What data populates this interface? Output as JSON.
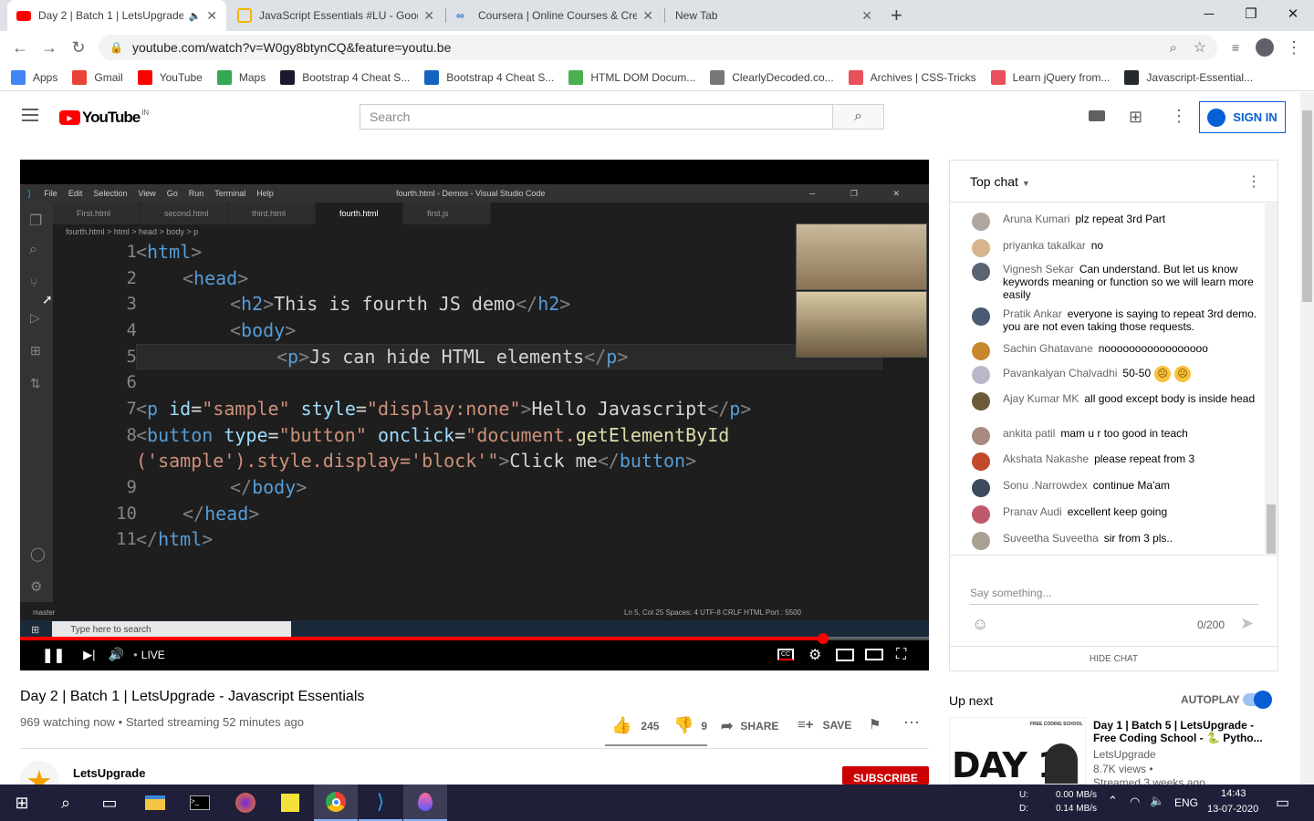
{
  "browser": {
    "tabs": [
      {
        "title": "Day 2 | Batch 1 | LetsUpgrade",
        "active": true,
        "icon": "youtube-favicon",
        "color": "#ff0000"
      },
      {
        "title": "JavaScript Essentials #LU - Goog",
        "active": false,
        "icon": "slides-favicon",
        "color": "#f4b400"
      },
      {
        "title": "Coursera | Online Courses & Cred",
        "active": false,
        "icon": "coursera-favicon",
        "color": "#2a73cc"
      },
      {
        "title": "New Tab",
        "active": false,
        "icon": "none",
        "color": "#dee1e6"
      }
    ],
    "url": "youtube.com/watch?v=W0gy8btynCQ&feature=youtu.be",
    "bookmarks": [
      {
        "label": "Apps",
        "icon": "apps-grid-icon",
        "color": "#4285f4"
      },
      {
        "label": "Gmail",
        "icon": "gmail-icon",
        "color": "#ea4335"
      },
      {
        "label": "YouTube",
        "icon": "youtube-icon",
        "color": "#ff0000"
      },
      {
        "label": "Maps",
        "icon": "maps-icon",
        "color": "#34a853"
      },
      {
        "label": "Bootstrap 4 Cheat S...",
        "icon": "h-icon",
        "color": "#1a1a2e"
      },
      {
        "label": "Bootstrap 4 Cheat S...",
        "icon": "arrow-icon",
        "color": "#1565c0"
      },
      {
        "label": "HTML DOM Docum...",
        "icon": "w3-icon",
        "color": "#4caf50"
      },
      {
        "label": "ClearlyDecoded.co...",
        "icon": "spiral-icon",
        "color": "#777777"
      },
      {
        "label": "Archives | CSS-Tricks",
        "icon": "star-icon",
        "color": "#e8505b"
      },
      {
        "label": "Learn jQuery from...",
        "icon": "star-icon",
        "color": "#e8505b"
      },
      {
        "label": "Javascript-Essential...",
        "icon": "github-icon",
        "color": "#24292e"
      }
    ]
  },
  "youtube": {
    "logo": "YouTube",
    "region": "IN",
    "search_placeholder": "Search",
    "signin_label": "SIGN IN"
  },
  "video": {
    "editor_title": "fourth.html - Demos - Visual Studio Code",
    "menu": [
      "File",
      "Edit",
      "Selection",
      "View",
      "Go",
      "Run",
      "Terminal",
      "Help"
    ],
    "file_tabs": [
      "First.html",
      "second.html",
      "third.html",
      "fourth.html",
      "first.js"
    ],
    "breadcrumb": "fourth.html > html > head > body > p",
    "line_numbers": [
      "1",
      "2",
      "3",
      "4",
      "5",
      "6",
      "7",
      "8",
      "",
      "9",
      "10",
      "11"
    ],
    "status_left": "master",
    "status_right": "Ln 5, Col 25   Spaces: 4   UTF-8   CRLF   HTML   Port : 5500",
    "taskbar_search": "Type here to search",
    "live_label": "LIVE",
    "progress_fraction": 0.884
  },
  "chat": {
    "header": "Top chat",
    "messages": [
      {
        "author": "Aruna Kumari",
        "text": "plz repeat 3rd Part",
        "avatar": "#b0a7a0"
      },
      {
        "author": "priyanka takalkar",
        "text": "no",
        "avatar": "#d8b48c"
      },
      {
        "author": "Vignesh Sekar",
        "text": "Can understand. But let us know keywords meaning or function so we will learn more easily",
        "avatar": "#5a6470"
      },
      {
        "author": "Pratik Ankar",
        "text": "everyone is saying to repeat 3rd demo. you are not even taking those requests.",
        "avatar": "#4a5a74"
      },
      {
        "author": "Sachin Ghatavane",
        "text": "nooooooooooooooooo",
        "avatar": "#c8872c"
      },
      {
        "author": "Pavankalyan Chalvadhi",
        "text": "50-50",
        "avatar": "#b8b8c8"
      },
      {
        "author": "Ajay Kumar MK",
        "text": "all good except body is inside head",
        "avatar": "#6a5a3a"
      },
      {
        "author": "ankita patil",
        "text": "mam u r too good in teach",
        "avatar": "#a88a80"
      },
      {
        "author": "Akshata Nakashe",
        "text": "please repeat from 3",
        "avatar": "#c04a2a"
      },
      {
        "author": "Sonu .Narrowdex",
        "text": "continue Ma'am",
        "avatar": "#3a4a5a"
      },
      {
        "author": "Pranav Audi",
        "text": "excellent keep going",
        "avatar": "#c05a6a"
      },
      {
        "author": "Suveetha Suveetha",
        "text": "sir from 3 pls..",
        "avatar": "#a8a090"
      }
    ],
    "input_placeholder": "Say something...",
    "counter": "0/200",
    "hide_label": "HIDE CHAT"
  },
  "info": {
    "title": "Day 2 | Batch 1 | LetsUpgrade - Javascript Essentials",
    "meta": "969 watching now • Started streaming 52 minutes ago",
    "likes": "245",
    "dislikes": "9",
    "share": "SHARE",
    "save": "SAVE",
    "channel": "LetsUpgrade",
    "subscribe": "SUBSCRIBE"
  },
  "upnext": {
    "header": "Up next",
    "autoplay": "AUTOPLAY",
    "item": {
      "title": "Day 1 | Batch 5 | LetsUpgrade - Free Coding School - 🐍 Pytho...",
      "channel": "LetsUpgrade",
      "views": "8.7K views •",
      "age": "Streamed 3 weeks ago",
      "thumb_text": "DAY 1",
      "thumb_badge": "FREE CODING SCHOOL"
    }
  },
  "tray": {
    "net_up": "0.00 MB/s",
    "net_down": "0.14 MB/s",
    "net_up_label": "U:",
    "net_down_label": "D:",
    "lang": "ENG",
    "time": "14:43",
    "date": "13-07-2020"
  }
}
